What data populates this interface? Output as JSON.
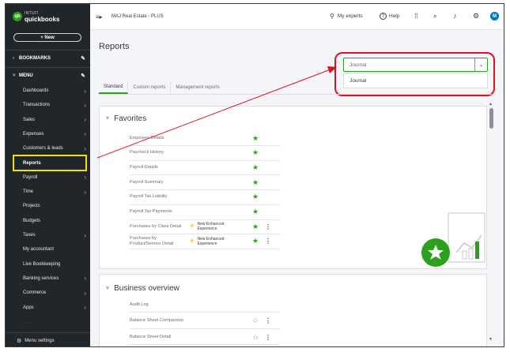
{
  "sidebar": {
    "logo_line1": "INTUIT",
    "logo_line2": "quickbooks",
    "new_label": "+ New",
    "bookmarks_label": "BOOKMARKS",
    "menu_label": "MENU",
    "items": [
      {
        "label": "Dashboards",
        "arrow": true
      },
      {
        "label": "Transactions",
        "arrow": true
      },
      {
        "label": "Sales",
        "arrow": true
      },
      {
        "label": "Expenses",
        "arrow": true
      },
      {
        "label": "Customers & leads",
        "arrow": true
      },
      {
        "label": "Reports",
        "arrow": false
      },
      {
        "label": "Payroll",
        "arrow": true
      },
      {
        "label": "Time",
        "arrow": true
      },
      {
        "label": "Projects",
        "arrow": false
      },
      {
        "label": "Budgets",
        "arrow": false
      },
      {
        "label": "Taxes",
        "arrow": true
      },
      {
        "label": "My accountant",
        "arrow": false
      },
      {
        "label": "Live Bookkeeping",
        "arrow": false
      },
      {
        "label": "Banking services",
        "arrow": true
      },
      {
        "label": "Commerce",
        "arrow": true
      },
      {
        "label": "Apps",
        "arrow": true
      }
    ],
    "menu_settings_label": "Menu settings"
  },
  "topbar": {
    "company_name": "MAJ Real Estate - PLUS",
    "my_experts_label": "My experts",
    "help_label": "Help",
    "avatar_initial": "M"
  },
  "main": {
    "page_title": "Reports",
    "search": {
      "value": "Journal"
    },
    "dropdown_option": "Journal",
    "tabs": [
      "Standard",
      "Custom reports",
      "Management reports"
    ],
    "favorites": {
      "title": "Favorites",
      "rows": [
        {
          "name": "Employee Details",
          "badge": "",
          "starred": true,
          "more": false
        },
        {
          "name": "Paycheck History",
          "badge": "",
          "starred": true,
          "more": false
        },
        {
          "name": "Payroll Details",
          "badge": "",
          "starred": true,
          "more": false
        },
        {
          "name": "Payroll Summary",
          "badge": "",
          "starred": true,
          "more": false
        },
        {
          "name": "Payroll Tax Liability",
          "badge": "",
          "starred": true,
          "more": false
        },
        {
          "name": "Payroll Tax Payments",
          "badge": "",
          "starred": true,
          "more": false
        },
        {
          "name": "Purchases by Class Detail",
          "badge": "New Enhanced Experience",
          "starred": true,
          "more": true
        },
        {
          "name": "Purchases by Product/Service Detail",
          "badge": "New Enhanced Experience",
          "starred": true,
          "more": true
        }
      ]
    },
    "business_overview": {
      "title": "Business overview",
      "rows": [
        {
          "name": "Audit Log",
          "starred": false,
          "more": false,
          "star_shown": false
        },
        {
          "name": "Balance Sheet Comparison",
          "starred": false,
          "more": true,
          "star_shown": true
        },
        {
          "name": "Balance Sheet Detail",
          "starred": false,
          "more": true,
          "star_shown": true
        }
      ]
    }
  },
  "colors": {
    "sidebar_bg": "#21262b",
    "brand_green": "#2ca01c",
    "highlight_red": "#e10f1f",
    "highlight_yellow": "#f3e20a"
  }
}
